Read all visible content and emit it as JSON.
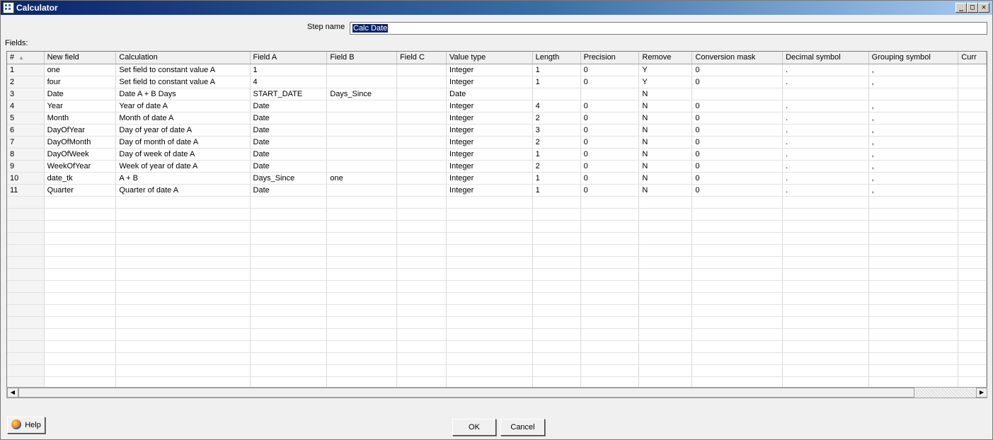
{
  "window": {
    "title": "Calculator",
    "controls": {
      "minimize": "_",
      "maximize": "□",
      "close": "✕"
    }
  },
  "step_name": {
    "label": "Step name",
    "value": "Calc Date"
  },
  "fields_label": "Fields:",
  "table": {
    "columns": [
      "#",
      "New field",
      "Calculation",
      "Field A",
      "Field B",
      "Field C",
      "Value type",
      "Length",
      "Precision",
      "Remove",
      "Conversion mask",
      "Decimal symbol",
      "Grouping symbol",
      "Curr"
    ],
    "rows": [
      [
        "1",
        "one",
        "Set field to constant value A",
        "1",
        "",
        "",
        "Integer",
        "1",
        "0",
        "Y",
        "0",
        ".",
        ","
      ],
      [
        "2",
        "four",
        "Set field to constant value A",
        "4",
        "",
        "",
        "Integer",
        "1",
        "0",
        "Y",
        "0",
        ".",
        ","
      ],
      [
        "3",
        "Date",
        "Date A + B Days",
        "START_DATE",
        "Days_Since",
        "",
        "Date",
        "",
        "",
        "N",
        "",
        "",
        ""
      ],
      [
        "4",
        "Year",
        "Year of date A",
        "Date",
        "",
        "",
        "Integer",
        "4",
        "0",
        "N",
        "0",
        ".",
        ","
      ],
      [
        "5",
        "Month",
        "Month of date A",
        "Date",
        "",
        "",
        "Integer",
        "2",
        "0",
        "N",
        "0",
        ".",
        ","
      ],
      [
        "6",
        "DayOfYear",
        "Day of year of date A",
        "Date",
        "",
        "",
        "Integer",
        "3",
        "0",
        "N",
        "0",
        ".",
        ","
      ],
      [
        "7",
        "DayOfMonth",
        "Day of month of date A",
        "Date",
        "",
        "",
        "Integer",
        "2",
        "0",
        "N",
        "0",
        ".",
        ","
      ],
      [
        "8",
        "DayOfWeek",
        "Day of week of date A",
        "Date",
        "",
        "",
        "Integer",
        "1",
        "0",
        "N",
        "0",
        ".",
        ","
      ],
      [
        "9",
        "WeekOfYear",
        "Week of year of date A",
        "Date",
        "",
        "",
        "Integer",
        "2",
        "0",
        "N",
        "0",
        ".",
        ","
      ],
      [
        "10",
        "date_tk",
        "A + B",
        "Days_Since",
        "one",
        "",
        "Integer",
        "1",
        "0",
        "N",
        "0",
        ".",
        ","
      ],
      [
        "11",
        "Quarter",
        "Quarter of date A",
        "Date",
        "",
        "",
        "Integer",
        "1",
        "0",
        "N",
        "0",
        ".",
        ","
      ]
    ]
  },
  "buttons": {
    "help": "Help",
    "ok": "OK",
    "cancel": "Cancel"
  }
}
